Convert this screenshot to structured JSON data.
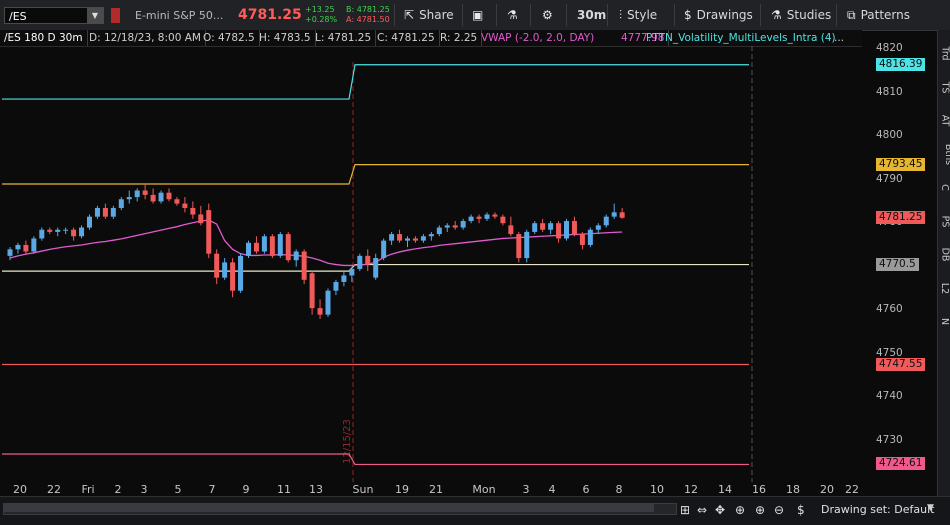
{
  "toolbar": {
    "symbol": "/ES",
    "symbol_dropdown": "▼",
    "description": "E-mini S&P 50...",
    "last_price": "4781.25",
    "net_change": "+13.25",
    "pct_change": "+0.28%",
    "bid": "B: 4781.25",
    "ask": "A: 4781.50",
    "share_label": "Share",
    "timeframe_label": "30m",
    "style_label": "Style",
    "drawings_label": "Drawings",
    "studies_label": "Studies",
    "patterns_label": "Patterns"
  },
  "infobar": {
    "title": "/ES 180 D 30m",
    "date": "D: 12/18/23, 8:00 AM",
    "open": "O: 4782.5",
    "high": "H: 4783.5",
    "low": "L: 4781.25",
    "close": "C: 4781.25",
    "range": "R: 2.25",
    "vwap_label": "VWAP (-2.0, 2.0, DAY)",
    "vwap_value": "4777.98",
    "study_label": "PTTN_Volatility_MultiLevels_Intra (4)",
    "more": "..."
  },
  "price_axis": {
    "labels": [
      "4820",
      "4810",
      "4800",
      "4790",
      "4780",
      "4770",
      "4760",
      "4750",
      "4740",
      "4730"
    ],
    "bubbles": [
      {
        "text": "4816.39",
        "color": "#4ee3e6"
      },
      {
        "text": "4793.45",
        "color": "#e6b630"
      },
      {
        "text": "4781.25",
        "color": "#f05a5a"
      },
      {
        "text": "4770.5",
        "color": "#9a9a9a"
      },
      {
        "text": "4747.55",
        "color": "#f05a5a"
      },
      {
        "text": "4724.61",
        "color": "#f05a8a"
      }
    ]
  },
  "time_axis": {
    "labels": [
      "20",
      "22",
      "Fri",
      "2",
      "3",
      "5",
      "7",
      "9",
      "11",
      "13",
      "Sun",
      "19",
      "21",
      "Mon",
      "3",
      "4",
      "6",
      "8",
      "10",
      "12",
      "14",
      "16",
      "18",
      "20",
      "22"
    ]
  },
  "chart": {
    "date_marker": "12/15/23",
    "colors": {
      "up": "#5aa9e6",
      "down": "#f05a5a",
      "vwap": "#e05ad0",
      "level_cyan": "#4ee3e6",
      "level_gold": "#e6b630",
      "level_white": "#e8e8c8",
      "level_red": "#f05a5a",
      "level_pink": "#f05a8a"
    },
    "candles": [
      [
        4772.5,
        4774.5,
        4771.5,
        4774.0
      ],
      [
        4774.0,
        4775.5,
        4773.0,
        4775.0
      ],
      [
        4775.0,
        4776.0,
        4773.0,
        4773.5
      ],
      [
        4773.5,
        4777.0,
        4773.0,
        4776.5
      ],
      [
        4776.5,
        4779.0,
        4776.0,
        4778.5
      ],
      [
        4778.5,
        4779.0,
        4777.5,
        4778.0
      ],
      [
        4778.0,
        4779.0,
        4777.0,
        4778.5
      ],
      [
        4778.5,
        4779.0,
        4777.5,
        4778.5
      ],
      [
        4778.5,
        4779.0,
        4776.0,
        4777.0
      ],
      [
        4777.0,
        4779.5,
        4776.5,
        4779.0
      ],
      [
        4779.0,
        4782.0,
        4778.5,
        4781.5
      ],
      [
        4781.5,
        4784.0,
        4781.0,
        4783.5
      ],
      [
        4783.5,
        4784.5,
        4781.0,
        4781.5
      ],
      [
        4781.5,
        4784.0,
        4781.0,
        4783.5
      ],
      [
        4783.5,
        4786.0,
        4783.0,
        4785.5
      ],
      [
        4785.5,
        4787.5,
        4784.5,
        4786.0
      ],
      [
        4786.0,
        4788.0,
        4785.0,
        4787.5
      ],
      [
        4787.5,
        4789.0,
        4785.5,
        4786.5
      ],
      [
        4786.5,
        4788.0,
        4784.5,
        4785.0
      ],
      [
        4785.0,
        4787.5,
        4784.5,
        4787.0
      ],
      [
        4787.0,
        4788.0,
        4785.0,
        4785.5
      ],
      [
        4785.5,
        4786.0,
        4784.0,
        4784.5
      ],
      [
        4784.5,
        4786.0,
        4782.5,
        4783.5
      ],
      [
        4783.5,
        4785.0,
        4781.0,
        4782.0
      ],
      [
        4782.0,
        4784.0,
        4779.5,
        4780.0
      ],
      [
        4783.0,
        4784.5,
        4772.0,
        4773.0
      ],
      [
        4773.0,
        4774.0,
        4766.0,
        4767.5
      ],
      [
        4767.5,
        4772.0,
        4767.0,
        4771.0
      ],
      [
        4771.0,
        4772.0,
        4763.0,
        4764.5
      ],
      [
        4764.5,
        4773.0,
        4764.0,
        4772.5
      ],
      [
        4772.5,
        4776.0,
        4772.0,
        4775.5
      ],
      [
        4775.5,
        4777.0,
        4773.0,
        4773.5
      ],
      [
        4773.5,
        4777.5,
        4773.0,
        4777.0
      ],
      [
        4777.0,
        4777.5,
        4772.0,
        4772.5
      ],
      [
        4772.5,
        4778.0,
        4772.0,
        4777.5
      ],
      [
        4777.5,
        4778.0,
        4771.0,
        4771.5
      ],
      [
        4771.5,
        4774.0,
        4770.0,
        4773.5
      ],
      [
        4773.5,
        4774.0,
        4766.0,
        4767.0
      ],
      [
        4768.5,
        4769.0,
        4759.0,
        4760.5
      ],
      [
        4760.5,
        4762.5,
        4758.0,
        4759.0
      ],
      [
        4759.0,
        4765.0,
        4758.5,
        4764.5
      ],
      [
        4764.5,
        4767.0,
        4763.5,
        4766.5
      ],
      [
        4766.5,
        4769.0,
        4765.5,
        4768.0
      ],
      [
        4768.0,
        4770.0,
        4766.5,
        4769.5
      ],
      [
        4769.5,
        4773.0,
        4769.0,
        4772.5
      ],
      [
        4772.5,
        4774.0,
        4769.0,
        4770.5
      ],
      [
        4767.5,
        4773.0,
        4767.0,
        4772.0
      ],
      [
        4772.0,
        4776.5,
        4771.5,
        4776.0
      ],
      [
        4776.0,
        4778.0,
        4775.0,
        4777.5
      ],
      [
        4777.5,
        4778.5,
        4775.5,
        4776.0
      ],
      [
        4776.0,
        4777.0,
        4774.5,
        4776.5
      ],
      [
        4776.5,
        4777.0,
        4775.5,
        4776.0
      ],
      [
        4776.0,
        4777.5,
        4775.5,
        4777.0
      ],
      [
        4777.0,
        4778.0,
        4776.0,
        4777.5
      ],
      [
        4777.5,
        4779.5,
        4777.0,
        4779.0
      ],
      [
        4779.0,
        4780.0,
        4778.0,
        4779.5
      ],
      [
        4779.5,
        4780.5,
        4778.5,
        4779.0
      ],
      [
        4779.0,
        4781.0,
        4778.5,
        4780.5
      ],
      [
        4780.5,
        4782.0,
        4780.0,
        4781.5
      ],
      [
        4781.5,
        4782.0,
        4780.0,
        4781.0
      ],
      [
        4781.0,
        4782.5,
        4780.5,
        4782.0
      ],
      [
        4782.0,
        4782.5,
        4781.0,
        4781.5
      ],
      [
        4781.5,
        4782.0,
        4779.5,
        4780.0
      ],
      [
        4779.5,
        4781.5,
        4777.0,
        4777.5
      ],
      [
        4777.5,
        4778.0,
        4771.0,
        4772.0
      ],
      [
        4772.0,
        4778.5,
        4771.0,
        4778.0
      ],
      [
        4778.0,
        4780.5,
        4777.5,
        4780.0
      ],
      [
        4780.0,
        4781.0,
        4778.0,
        4778.5
      ],
      [
        4778.5,
        4780.5,
        4777.5,
        4780.0
      ],
      [
        4780.0,
        4780.5,
        4775.5,
        4776.5
      ],
      [
        4776.5,
        4781.0,
        4776.0,
        4780.5
      ],
      [
        4780.5,
        4781.5,
        4777.0,
        4777.5
      ],
      [
        4777.5,
        4778.0,
        4774.0,
        4775.0
      ],
      [
        4775.0,
        4779.0,
        4774.5,
        4778.5
      ],
      [
        4778.5,
        4780.0,
        4777.5,
        4779.5
      ],
      [
        4779.5,
        4782.0,
        4779.0,
        4781.5
      ],
      [
        4781.5,
        4784.5,
        4781.0,
        4782.5
      ],
      [
        4782.5,
        4783.5,
        4781.0,
        4781.25
      ]
    ],
    "vwap": [
      4772.0,
      4772.5,
      4772.9,
      4773.2,
      4773.6,
      4774.0,
      4774.3,
      4774.6,
      4774.8,
      4775.0,
      4775.3,
      4775.6,
      4775.8,
      4776.1,
      4776.4,
      4776.8,
      4777.2,
      4777.6,
      4778.0,
      4778.4,
      4778.8,
      4779.2,
      4779.7,
      4780.1,
      4780.5,
      4780.7,
      4779.8,
      4776.0,
      4774.0,
      4773.0,
      4772.6,
      4772.6,
      4772.7,
      4772.7,
      4772.8,
      4772.7,
      4772.6,
      4772.4,
      4772.0,
      4771.5,
      4770.8,
      4770.5,
      4770.3,
      4770.3,
      4770.4,
      4770.6,
      4771.0,
      4772.2,
      4772.9,
      4773.4,
      4773.8,
      4774.1,
      4774.4,
      4774.6,
      4774.9,
      4775.1,
      4775.3,
      4775.5,
      4775.7,
      4775.9,
      4776.1,
      4776.3,
      4776.5,
      4776.6,
      4776.7,
      4776.8,
      4776.9,
      4777.0,
      4777.1,
      4777.2,
      4777.3,
      4777.4,
      4777.5,
      4777.6,
      4777.7,
      4777.8,
      4777.9,
      4777.98
    ],
    "levels": [
      {
        "name": "cyan",
        "before": 4808.5,
        "after": 4816.39,
        "color": "#4ee3e6"
      },
      {
        "name": "gold",
        "before": 4789.0,
        "after": 4793.45,
        "color": "#e6b630"
      },
      {
        "name": "white",
        "before": 4769.0,
        "after": 4770.5,
        "color": "#e8e8c8"
      },
      {
        "name": "red",
        "before": 4747.55,
        "after": 4747.55,
        "color": "#f05a5a"
      },
      {
        "name": "pink",
        "before": 4727.0,
        "after": 4724.61,
        "color": "#f05a8a"
      }
    ]
  },
  "right_strip": [
    "Trd",
    "TS",
    "AT",
    "Btns",
    "C",
    "PS",
    "DB",
    "L2",
    "N"
  ],
  "bottom": {
    "drawing_set": "Drawing set: Default",
    "dropdown": "▼"
  }
}
